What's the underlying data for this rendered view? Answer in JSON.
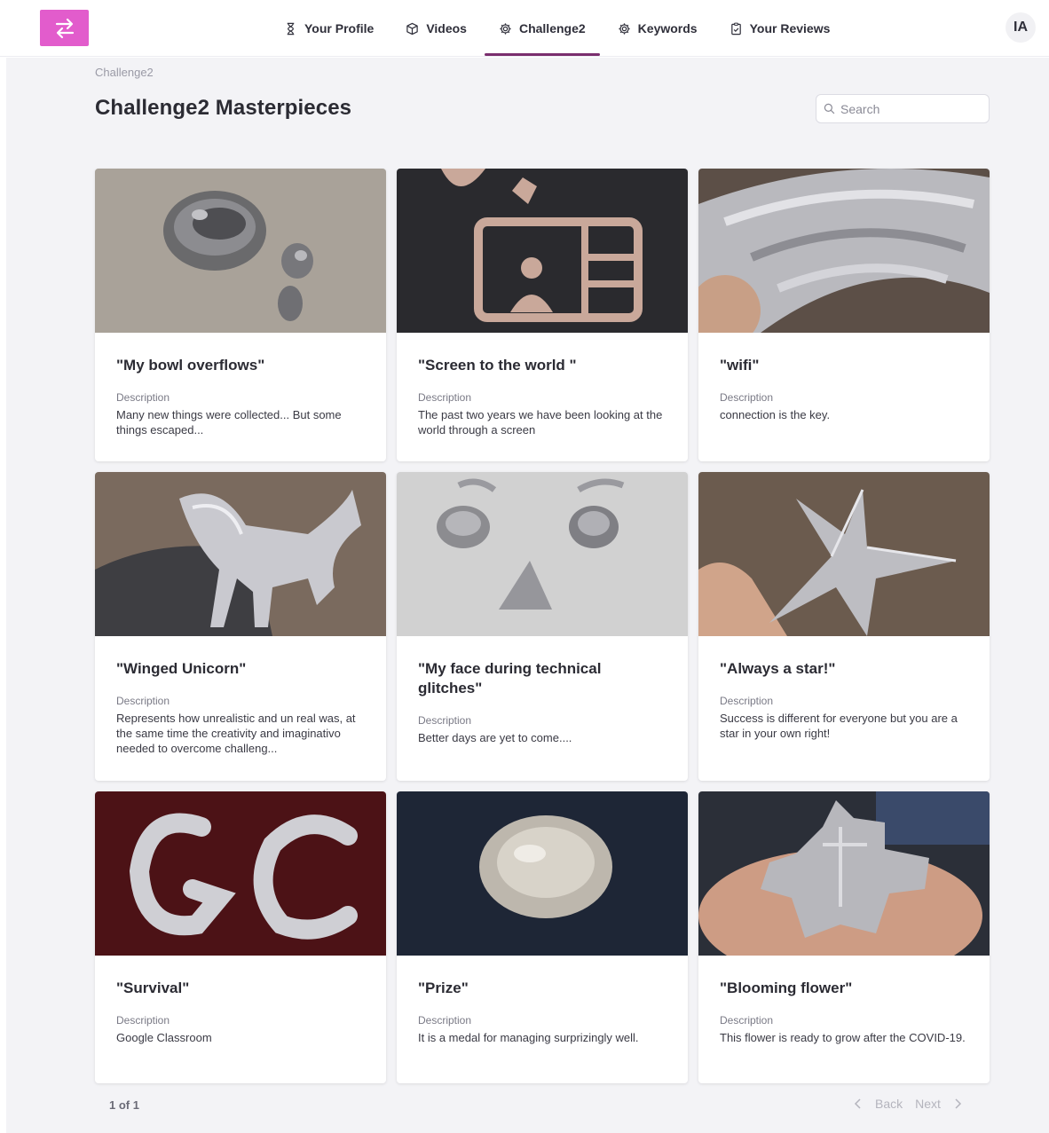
{
  "nav": {
    "items": [
      {
        "label": "Your Profile",
        "icon": "hourglass-icon"
      },
      {
        "label": "Videos",
        "icon": "cube-icon"
      },
      {
        "label": "Challenge2",
        "icon": "gear-icon",
        "active": true
      },
      {
        "label": "Keywords",
        "icon": "gear-icon"
      },
      {
        "label": "Your Reviews",
        "icon": "clipboard-check-icon"
      }
    ],
    "avatar_initials": "IA"
  },
  "breadcrumb": "Challenge2",
  "page_title": "Challenge2 Masterpieces",
  "search": {
    "placeholder": "Search",
    "value": ""
  },
  "description_label": "Description",
  "cards": [
    {
      "title": "\"My bowl overflows\"",
      "description": "Many new things were collected... But some things escaped..."
    },
    {
      "title": "\"Screen to the world \"",
      "description": "The past two years we have been looking at the world through a screen"
    },
    {
      "title": "\"wifi\"",
      "description": "connection is the key."
    },
    {
      "title": "\"Winged Unicorn\"",
      "description": "Represents how unrealistic and un real was, at the same time the creativity and imaginativo needed to overcome challeng..."
    },
    {
      "title": "\"My face during technical glitches\"",
      "description": "Better days are yet to come...."
    },
    {
      "title": "\"Always a star!\"",
      "description": "Success is different for everyone but you are a star in your own right!"
    },
    {
      "title": "\"Survival\"",
      "description": "Google Classroom"
    },
    {
      "title": "\"Prize\"",
      "description": "It is a medal for managing surprizingly well."
    },
    {
      "title": "\"Blooming flower\"",
      "description": "This flower is ready to grow after the COVID-19."
    }
  ],
  "pagination": {
    "count": "1 of 1",
    "back_label": "Back",
    "next_label": "Next"
  },
  "colors": {
    "brand": "#e25ccc",
    "active_tab_underline": "#7a2e6e",
    "page_bg": "#f3f3f6"
  }
}
